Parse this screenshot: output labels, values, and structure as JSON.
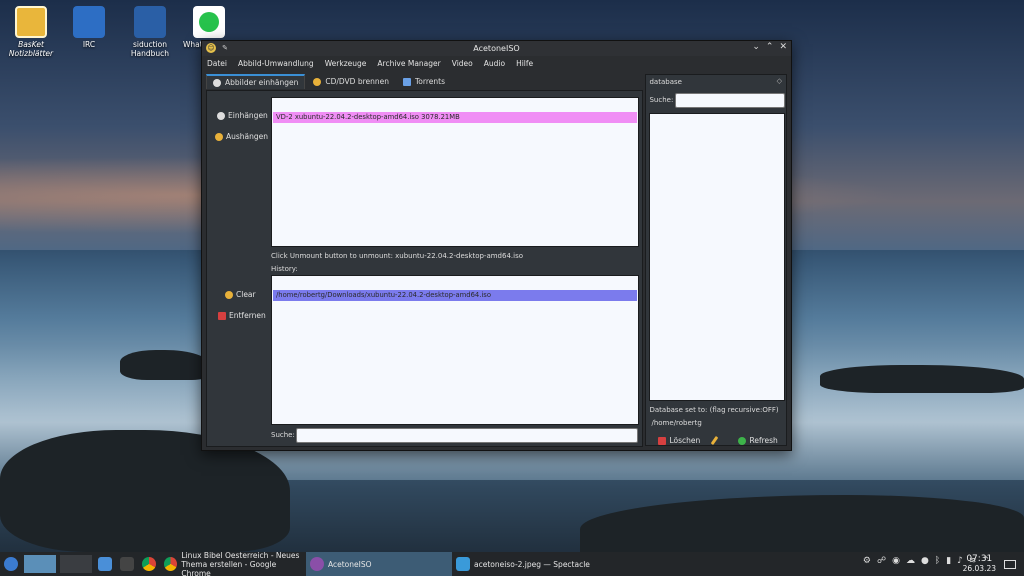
{
  "desktop": {
    "icons": [
      {
        "label": "BasKet",
        "label2": "Notizblätter"
      },
      {
        "label": "IRC"
      },
      {
        "label": "siduction",
        "label2": "Handbuch"
      },
      {
        "label": "What"
      }
    ]
  },
  "window": {
    "title": "AcetoneISO",
    "menu": [
      "Datei",
      "Abbild-Umwandlung",
      "Werkzeuge",
      "Archive Manager",
      "Video",
      "Audio",
      "Hilfe"
    ],
    "tabs": [
      "Abbilder einhängen",
      "CD/DVD brennen",
      "Torrents"
    ],
    "mount_button": "Einhängen",
    "unmount_button": "Aushängen",
    "mounted_item": "VD-2 xubuntu-22.04.2-desktop-amd64.iso  3078.21MB",
    "unmount_hint": "Click Unmount button to unmount: xubuntu-22.04.2-desktop-amd64.iso",
    "history_label": "History:",
    "clear_button": "Clear",
    "remove_button": "Entfernen",
    "history_item": "/home/robertg/Downloads/xubuntu-22.04.2-desktop-amd64.iso",
    "search_label": "Suche:",
    "search_value": "",
    "database": {
      "title": "database",
      "search_label": "Suche:",
      "search_value": "",
      "set_to_label": "Database set to:  (flag recursive:OFF)",
      "path": "/home/robertg",
      "delete_button": "Löschen",
      "refresh_button": "Refresh"
    }
  },
  "taskbar": {
    "tasks": [
      {
        "label": "Linux Bibel Oesterreich - Neues",
        "label2": "Thema erstellen - Google Chrome"
      },
      {
        "label": "AcetoneISO"
      },
      {
        "label": "acetoneiso-2.jpeg — Spectacle"
      }
    ],
    "time": "07:31",
    "date": "26.03.23"
  },
  "colors": {
    "mounted_row": "#f08ef5",
    "history_row": "#7b7bed",
    "tab_accent": "#3a8fd5"
  }
}
